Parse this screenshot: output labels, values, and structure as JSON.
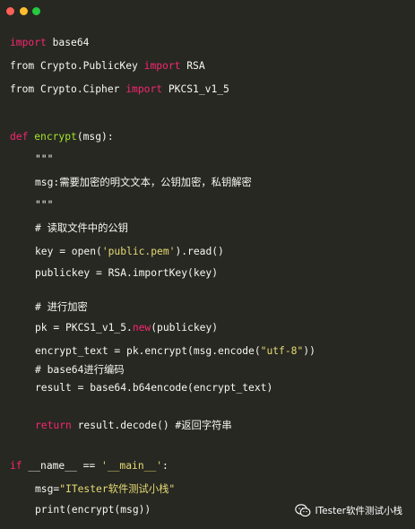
{
  "window": {
    "dot_colors": [
      "#ff5f56",
      "#ffbd2e",
      "#27c93f"
    ]
  },
  "code": {
    "l1": {
      "kw": "import",
      "rest": " base64"
    },
    "l2": {
      "a": "from Crypto.PublicKey ",
      "kw": "import",
      "b": " RSA"
    },
    "l3": {
      "a": "from Crypto.Cipher ",
      "kw": "import",
      "b": " PKCS1_v1_5"
    },
    "l4": {
      "kw": "def ",
      "fn": "encrypt",
      "rest": "(msg):"
    },
    "l5": "\"\"\"",
    "l6": "msg:需要加密的明文文本，公钥加密，私钥解密",
    "l7": "\"\"\"",
    "l8": "# 读取文件中的公钥",
    "l9": {
      "a": "key = open(",
      "str": "'public.pem'",
      "b": ").read()"
    },
    "l10": "publickey = RSA.importKey(key)",
    "l11": "# 进行加密",
    "l12": {
      "a": "pk = PKCS1_v1_5.",
      "kw": "new",
      "b": "(publickey)"
    },
    "l13": {
      "a": "encrypt_text = pk.encrypt(msg.encode(",
      "str": "\"utf-8\"",
      "b": "))"
    },
    "l14": "# base64进行编码",
    "l15": "result = base64.b64encode(encrypt_text)",
    "l16": {
      "kw": "return",
      "rest": " result.decode() #返回字符串"
    },
    "l17": {
      "kw": "if",
      "a": " __name__ == ",
      "str": "'__main__'",
      "b": ":"
    },
    "l18": {
      "a": "msg=",
      "str": "\"ITester软件测试小栈\""
    },
    "l19": "print(encrypt(msg))"
  },
  "watermark": {
    "text": "ITester软件测试小栈",
    "icon": "wechat-icon"
  }
}
